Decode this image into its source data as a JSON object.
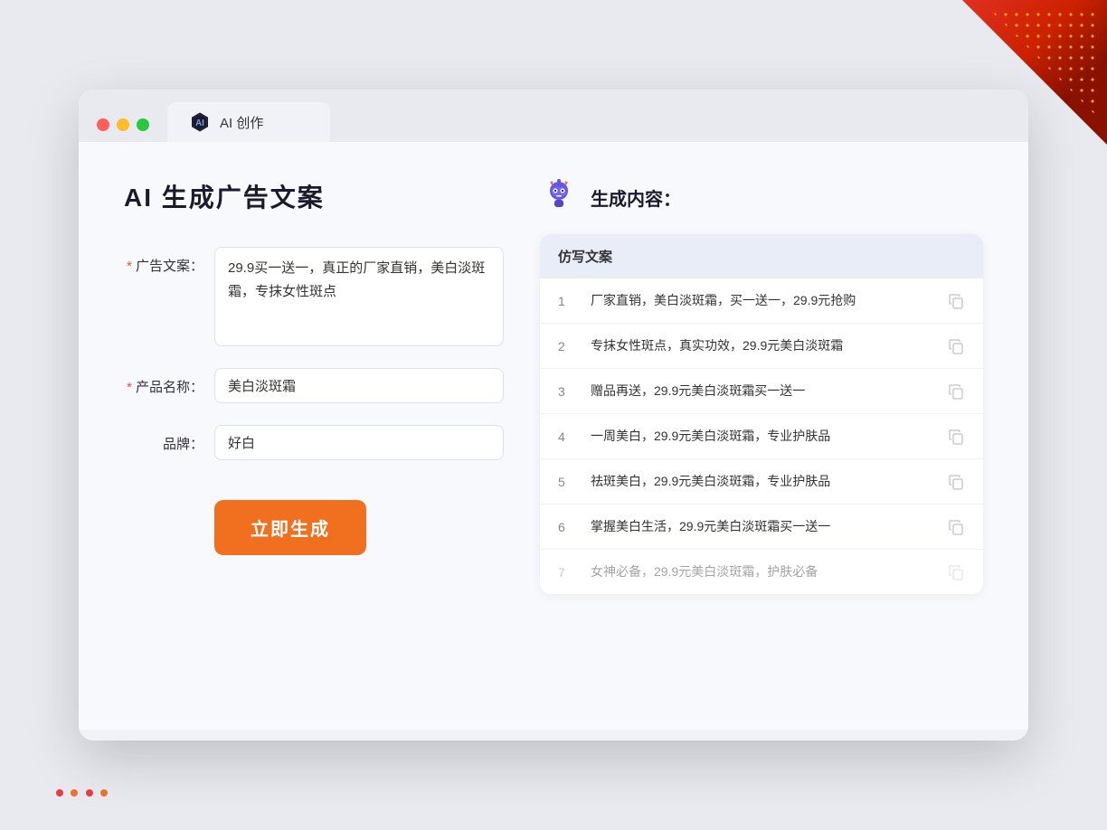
{
  "decorations": {
    "corner": "top-right red corner"
  },
  "browser": {
    "traffic_lights": [
      "red",
      "yellow",
      "green"
    ],
    "tab": {
      "icon_label": "AI icon",
      "title": "AI 创作"
    }
  },
  "left_panel": {
    "page_title": "AI 生成广告文案",
    "fields": [
      {
        "label": "广告文案：",
        "required": true,
        "type": "textarea",
        "value": "29.9买一送一，真正的厂家直销，美白淡斑霜，专抹女性斑点",
        "name": "ad-copy-field"
      },
      {
        "label": "产品名称：",
        "required": true,
        "type": "input",
        "value": "美白淡斑霜",
        "name": "product-name-field"
      },
      {
        "label": "品牌：",
        "required": false,
        "type": "input",
        "value": "好白",
        "name": "brand-field"
      }
    ],
    "generate_button": "立即生成"
  },
  "right_panel": {
    "robot_icon_label": "robot-icon",
    "title": "生成内容：",
    "table_header": "仿写文案",
    "results": [
      {
        "num": "1",
        "text": "厂家直销，美白淡斑霜，买一送一，29.9元抢购",
        "faded": false
      },
      {
        "num": "2",
        "text": "专抹女性斑点，真实功效，29.9元美白淡斑霜",
        "faded": false
      },
      {
        "num": "3",
        "text": "赠品再送，29.9元美白淡斑霜买一送一",
        "faded": false
      },
      {
        "num": "4",
        "text": "一周美白，29.9元美白淡斑霜，专业护肤品",
        "faded": false
      },
      {
        "num": "5",
        "text": "祛斑美白，29.9元美白淡斑霜，专业护肤品",
        "faded": false
      },
      {
        "num": "6",
        "text": "掌握美白生活，29.9元美白淡斑霜买一送一",
        "faded": false
      },
      {
        "num": "7",
        "text": "女神必备，29.9元美白淡斑霜，护肤必备",
        "faded": true
      }
    ]
  }
}
